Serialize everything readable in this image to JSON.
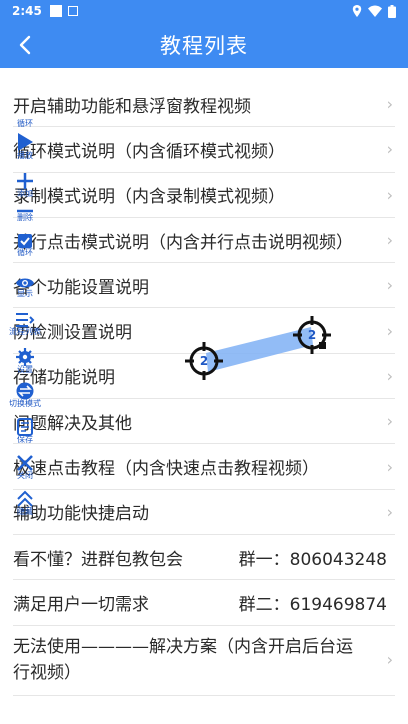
{
  "status_bar": {
    "time": "2:45",
    "icons": [
      "square-icon",
      "download-notification-icon",
      "location-icon",
      "wifi-icon",
      "battery-icon"
    ]
  },
  "header": {
    "title": "教程列表",
    "back_icon": "chevron-left-icon"
  },
  "list": {
    "items": [
      {
        "label": "开启辅助功能和悬浮窗教程视频"
      },
      {
        "label": "循环模式说明（内含循环模式视频）"
      },
      {
        "label": "录制模式说明（内含录制模式视频）"
      },
      {
        "label": "并行点击模式说明（内含并行点击说明视频）"
      },
      {
        "label": "各个功能设置说明"
      },
      {
        "label": "防检测设置说明"
      },
      {
        "label": "存储功能说明"
      },
      {
        "label": "问题解决及其他"
      },
      {
        "label": "极速点击教程（内含快速点击教程视频）"
      },
      {
        "label": "辅助功能快捷启动"
      }
    ],
    "group_rows": [
      {
        "left": "看不懂？进群包教包会",
        "right": "群一：806043248"
      },
      {
        "left": "满足用户一切需求",
        "right": "群二：619469874"
      }
    ],
    "last_item": "无法使用————解决方案（内含开启后台运行视频）"
  },
  "floating_toolbar": {
    "items": [
      {
        "label": "循环",
        "icon": "loop-icon"
      },
      {
        "label": "播放",
        "icon": "play-icon"
      },
      {
        "label": "添加",
        "icon": "plus-icon"
      },
      {
        "label": "删除",
        "icon": "minus-icon"
      },
      {
        "label": "循环",
        "icon": "checkbox-icon"
      },
      {
        "label": "显示",
        "icon": "eye-icon"
      },
      {
        "label": "流程列表",
        "icon": "list-icon"
      },
      {
        "label": "设置",
        "icon": "gear-icon"
      },
      {
        "label": "切换模式",
        "icon": "switch-mode-icon"
      },
      {
        "label": "保存",
        "icon": "save-icon"
      },
      {
        "label": "关闭",
        "icon": "close-icon"
      },
      {
        "label": "隐藏",
        "icon": "collapse-icon"
      }
    ]
  },
  "swipe_overlay": {
    "start_label": "2",
    "end_label": "2",
    "accent_color": "#1f58c4",
    "path_color": "#7fb0f5"
  },
  "colors": {
    "header": "#3e8bf2",
    "divider": "#e6e6e6",
    "chevron": "#bdbdbd"
  },
  "chevron_glyph": "›"
}
